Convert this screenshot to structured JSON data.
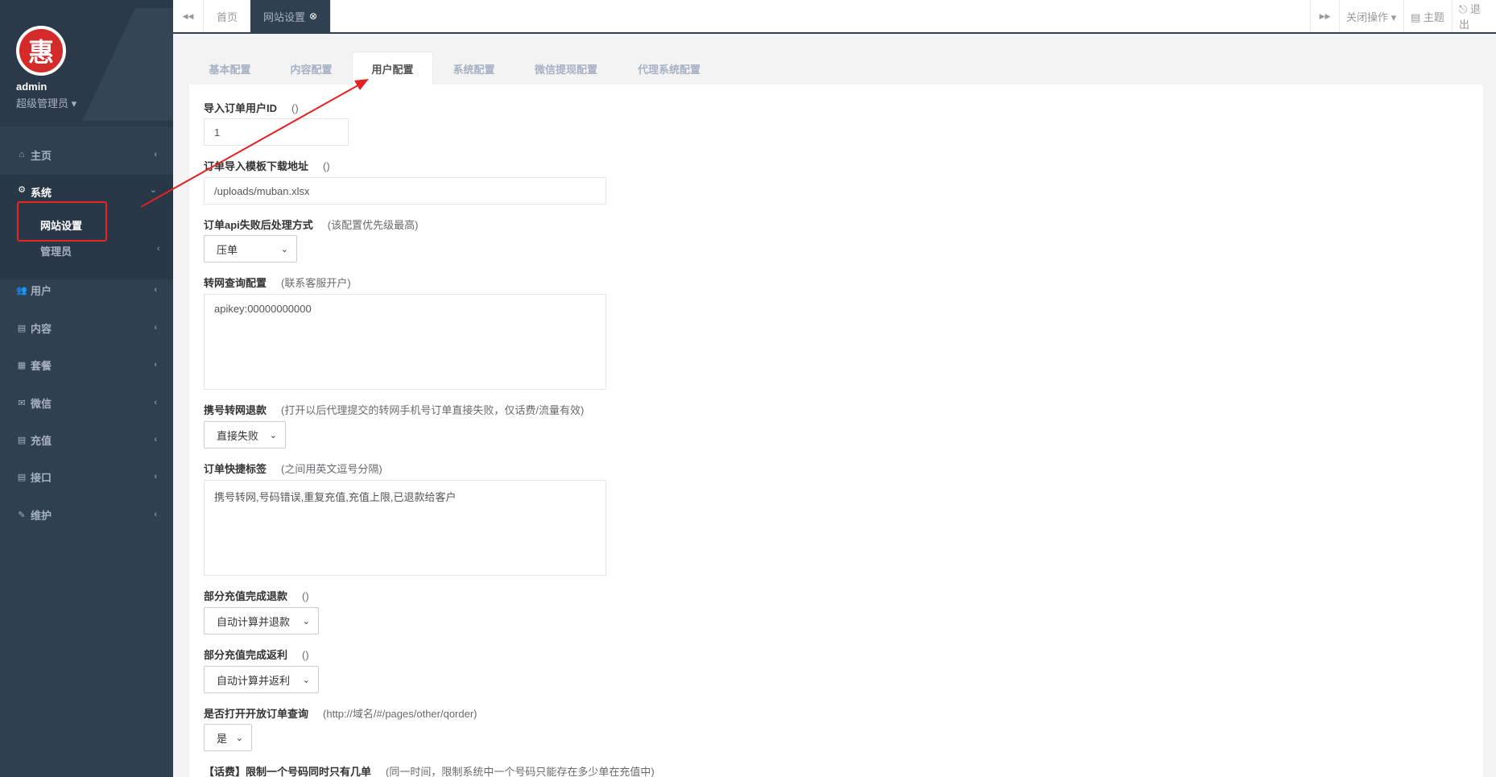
{
  "profile": {
    "name": "admin",
    "role": "超级管理员 ▾",
    "logo_char": "惠"
  },
  "sidebar": {
    "items": [
      {
        "label": "主页",
        "icon": "home-icon",
        "glyph": "⌂"
      },
      {
        "label": "系统",
        "icon": "gears-icon",
        "glyph": "⚙"
      },
      {
        "label": "用户",
        "icon": "users-icon",
        "glyph": "👥"
      },
      {
        "label": "内容",
        "icon": "file-icon",
        "glyph": "▤"
      },
      {
        "label": "套餐",
        "icon": "list-icon",
        "glyph": "▦"
      },
      {
        "label": "微信",
        "icon": "wechat-icon",
        "glyph": "✉"
      },
      {
        "label": "充值",
        "icon": "file-text-icon",
        "glyph": "▤"
      },
      {
        "label": "接口",
        "icon": "file-icon",
        "glyph": "▤"
      },
      {
        "label": "维护",
        "icon": "magic-icon",
        "glyph": "✎"
      }
    ],
    "sub_items": [
      {
        "label": "网站设置"
      },
      {
        "label": "管理员"
      }
    ]
  },
  "topbar": {
    "back_glyph": "◀◀",
    "forward_glyph": "▶▶",
    "tabs": [
      {
        "label": "首页"
      },
      {
        "label": "网站设置",
        "close": "⊗"
      }
    ],
    "close_ops": "关闭操作 ▾",
    "theme": "▤ 主题",
    "logout": "⎋ 退出"
  },
  "config_tabs": [
    {
      "label": "基本配置"
    },
    {
      "label": "内容配置"
    },
    {
      "label": "用户配置"
    },
    {
      "label": "系统配置"
    },
    {
      "label": "微信提现配置"
    },
    {
      "label": "代理系统配置"
    }
  ],
  "form": {
    "f1": {
      "label": "导入订单用户ID",
      "hint": "()",
      "value": "1"
    },
    "f2": {
      "label": "订单导入模板下载地址",
      "hint": "()",
      "value": "/uploads/muban.xlsx"
    },
    "f3": {
      "label": "订单api失败后处理方式",
      "hint": "(该配置优先级最高)",
      "value": "压单"
    },
    "f4": {
      "label": "转网查询配置",
      "hint": "(联系客服开户)",
      "value": "apikey:00000000000"
    },
    "f5": {
      "label": "携号转网退款",
      "hint": "(打开以后代理提交的转网手机号订单直接失败，仅话费/流量有效)",
      "value": "直接失败"
    },
    "f6": {
      "label": "订单快捷标签",
      "hint": "(之间用英文逗号分隔)",
      "value": "携号转网,号码错误,重复充值,充值上限,已退款给客户"
    },
    "f7": {
      "label": "部分充值完成退款",
      "hint": "()",
      "value": "自动计算并退款"
    },
    "f8": {
      "label": "部分充值完成返利",
      "hint": "()",
      "value": "自动计算并返利"
    },
    "f9": {
      "label": "是否打开开放订单查询",
      "hint": "(http://域名/#/pages/other/qorder)",
      "value": "是"
    },
    "f10": {
      "label": "【话费】限制一个号码同时只有几单",
      "hint": "(同一时间，限制系统中一个号码只能存在多少单在充值中)"
    }
  },
  "colors": {
    "sidebar": "#2f4050",
    "highlight": "#e22222"
  }
}
